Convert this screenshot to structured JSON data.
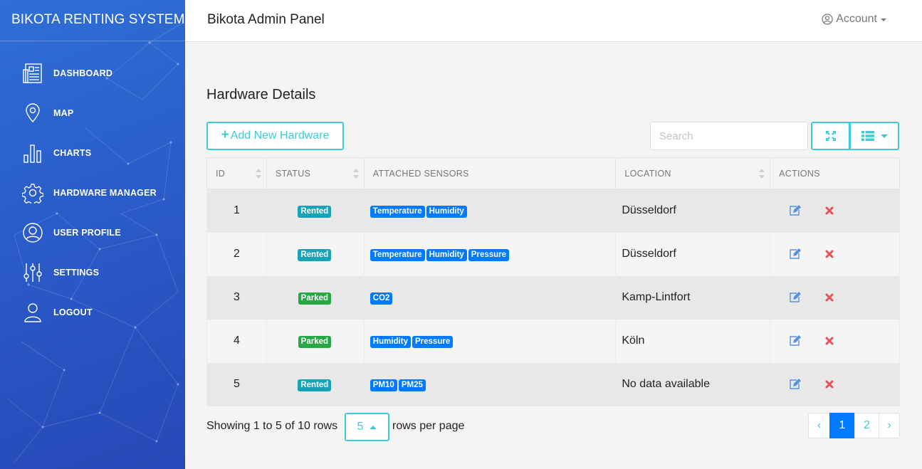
{
  "sidebar": {
    "brand": "BIKOTA RENTING SYSTEM",
    "items": [
      {
        "label": "DASHBOARD",
        "icon": "dashboard-icon"
      },
      {
        "label": "MAP",
        "icon": "map-pin-icon"
      },
      {
        "label": "CHARTS",
        "icon": "bar-chart-icon"
      },
      {
        "label": "HARDWARE MANAGER",
        "icon": "gear-icon"
      },
      {
        "label": "USER PROFILE",
        "icon": "user-circle-icon"
      },
      {
        "label": "SETTINGS",
        "icon": "sliders-icon"
      },
      {
        "label": "LOGOUT",
        "icon": "user-icon"
      }
    ]
  },
  "header": {
    "title": "Bikota Admin Panel",
    "account_label": "Account"
  },
  "main": {
    "heading": "Hardware Details",
    "add_button_label": "Add New Hardware",
    "search_placeholder": "Search",
    "columns": [
      "ID",
      "STATUS",
      "ATTACHED SENSORS",
      "LOCATION",
      "ACTIONS"
    ],
    "rows": [
      {
        "id": "1",
        "status": "Rented",
        "sensors": [
          "Temperature",
          "Humidity"
        ],
        "location": "Düsseldorf"
      },
      {
        "id": "2",
        "status": "Rented",
        "sensors": [
          "Temperature",
          "Humidity",
          "Pressure"
        ],
        "location": "Düsseldorf"
      },
      {
        "id": "3",
        "status": "Parked",
        "sensors": [
          "CO2"
        ],
        "location": "Kamp-Lintfort"
      },
      {
        "id": "4",
        "status": "Parked",
        "sensors": [
          "Humidity",
          "Pressure"
        ],
        "location": "Köln"
      },
      {
        "id": "5",
        "status": "Rented",
        "sensors": [
          "PM10",
          "PM25"
        ],
        "location": "No data available"
      }
    ]
  },
  "footer": {
    "showing_text": "Showing 1 to 5 of 10 rows",
    "page_size": "5",
    "rows_per_page_label": "rows per page",
    "pagination": {
      "prev": "‹",
      "pages": [
        "1",
        "2"
      ],
      "next": "›",
      "current": "1"
    }
  },
  "colors": {
    "accent": "#3ecbd6",
    "rented": "#17a2b8",
    "parked": "#28a745",
    "sensor": "#007bff",
    "delete": "#e8515a",
    "sidebar": "#2a5cc9"
  }
}
